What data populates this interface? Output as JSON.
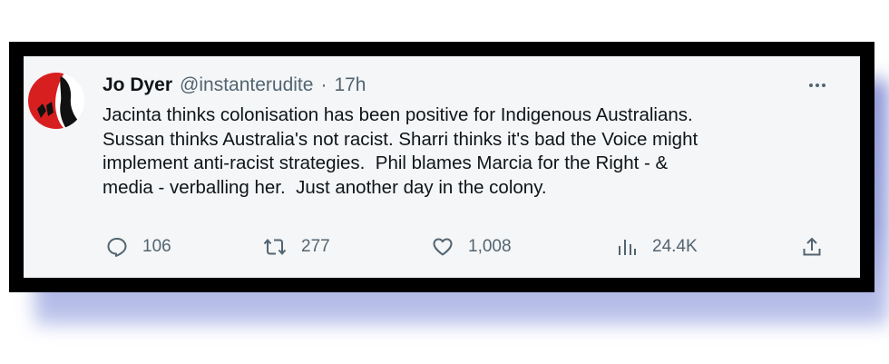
{
  "tweet": {
    "author_name": "Jo Dyer",
    "author_handle": "@instanterudite",
    "separator": "·",
    "time_ago": "17h",
    "text": "Jacinta thinks colonisation has been positive for Indigenous Australians.\nSussan thinks Australia's not racist. Sharri thinks it's bad the Voice might\nimplement anti-racist strategies.  Phil blames Marcia for the Right - &\nmedia - verballing her.  Just another day in the colony.",
    "avatar_icon": "avatar-image",
    "more_icon": "more-icon"
  },
  "actions": {
    "replies": {
      "icon": "reply-icon",
      "count": "106"
    },
    "retweets": {
      "icon": "retweet-icon",
      "count": "277"
    },
    "likes": {
      "icon": "heart-icon",
      "count": "1,008"
    },
    "views": {
      "icon": "views-icon",
      "count": "24.4K"
    },
    "share": {
      "icon": "share-icon"
    }
  },
  "colors": {
    "frame": "#000000",
    "card": "#f4f6f7",
    "shadow": "#8b97d8",
    "secondary_text": "#536471",
    "primary_text": "#0f1419"
  }
}
